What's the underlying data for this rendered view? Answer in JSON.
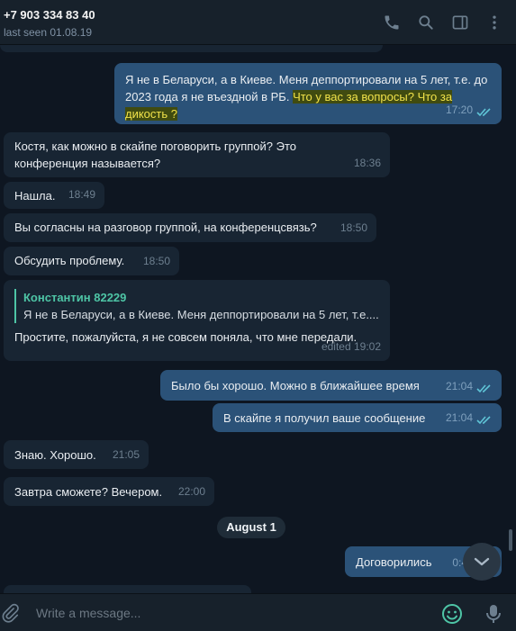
{
  "header": {
    "contact_name": "+7 903 334 83 40",
    "status": "last seen 01.08.19",
    "icons": [
      "phone-icon",
      "search-icon",
      "sidebar-icon",
      "more-icon"
    ]
  },
  "messages": [
    {
      "id": "m1",
      "direction": "out",
      "text_plain": "Я не в Беларуси, а в Киеве. Меня деппортировали на 5 лет, т.е. до 2023 года я не въездной в РБ. ",
      "text_highlight": "Что у вас за вопросы? Что за дикость ?",
      "time": "17:20",
      "read": true
    },
    {
      "id": "m2",
      "direction": "in",
      "text": "Костя, как можно в скайпе поговорить группой? Это конференция называется?",
      "time": "18:36"
    },
    {
      "id": "m3",
      "direction": "in",
      "text": "Нашла.",
      "time": "18:49"
    },
    {
      "id": "m4",
      "direction": "in",
      "text": "Вы согласны на разговор группой, на конференцсвязь?",
      "time": "18:50"
    },
    {
      "id": "m5",
      "direction": "in",
      "text": "Обсудить проблему.",
      "time": "18:50"
    },
    {
      "id": "m6",
      "direction": "in",
      "reply_author": "Константин 82229",
      "reply_text": "Я не в Беларуси, а в Киеве. Меня деппортировали на 5 лет, т.е....",
      "text": "Простите, пожалуйста, я не совсем поняла, что мне передали.",
      "time": "edited 19:02"
    },
    {
      "id": "m7",
      "direction": "out",
      "text": "Было бы хорошо. Можно в ближайшее время",
      "time": "21:04",
      "read": true
    },
    {
      "id": "m8",
      "direction": "out",
      "text": "В скайпе я получил ваше сообщение",
      "time": "21:04",
      "read": true
    },
    {
      "id": "m9",
      "direction": "in",
      "text": "Знаю. Хорошо.",
      "time": "21:05"
    },
    {
      "id": "m10",
      "direction": "in",
      "text": "Завтра сможете? Вечером.",
      "time": "22:00"
    },
    {
      "id": "m11",
      "direction": "out",
      "text": "Договорились",
      "time": "0:4"
    }
  ],
  "date_separator": "August 1",
  "composer": {
    "placeholder": "Write a message..."
  },
  "colors": {
    "background": "#0e1621",
    "header": "#17212b",
    "incoming": "#182533",
    "outgoing": "#2b5278",
    "highlight_text": "#f1e24a",
    "reply_accent": "#4ec5a6",
    "read_ticks": "#5fc4d6"
  }
}
